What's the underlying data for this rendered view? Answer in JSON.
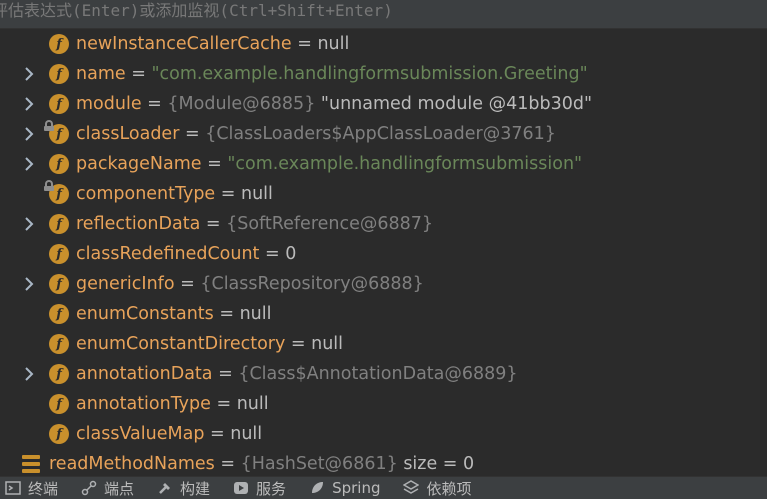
{
  "evaluate_bar": {
    "placeholder": "评估表达式(Enter)或添加监视(Ctrl+Shift+Enter)"
  },
  "variables": [
    {
      "name": "newInstanceCallerCache",
      "eq": "=",
      "value": "null",
      "value_type": "null",
      "expandable": false,
      "locked": false,
      "icon": "field-icon"
    },
    {
      "name": "name",
      "eq": "=",
      "value": "\"com.example.handlingformsubmission.Greeting\"",
      "value_type": "str",
      "expandable": true,
      "locked": false,
      "icon": "field-icon"
    },
    {
      "name": "module",
      "eq": "=",
      "ref": "{Module@6885}",
      "value": "\"unnamed module @41bb30d\"",
      "value_type": "plain",
      "expandable": true,
      "locked": false,
      "icon": "field-icon"
    },
    {
      "name": "classLoader",
      "eq": "=",
      "value": "{ClassLoaders$AppClassLoader@3761}",
      "value_type": "ref",
      "expandable": true,
      "locked": true,
      "icon": "field-icon"
    },
    {
      "name": "packageName",
      "eq": "=",
      "value": "\"com.example.handlingformsubmission\"",
      "value_type": "str",
      "expandable": true,
      "locked": false,
      "icon": "field-icon"
    },
    {
      "name": "componentType",
      "eq": "=",
      "value": "null",
      "value_type": "null",
      "expandable": false,
      "locked": true,
      "icon": "field-icon"
    },
    {
      "name": "reflectionData",
      "eq": "=",
      "value": "{SoftReference@6887}",
      "value_type": "ref",
      "expandable": true,
      "locked": false,
      "icon": "field-icon"
    },
    {
      "name": "classRedefinedCount",
      "eq": "=",
      "value": "0",
      "value_type": "num",
      "expandable": false,
      "locked": false,
      "icon": "field-icon"
    },
    {
      "name": "genericInfo",
      "eq": "=",
      "value": "{ClassRepository@6888}",
      "value_type": "ref",
      "expandable": true,
      "locked": false,
      "icon": "field-icon"
    },
    {
      "name": "enumConstants",
      "eq": "=",
      "value": "null",
      "value_type": "null",
      "expandable": false,
      "locked": false,
      "icon": "field-icon"
    },
    {
      "name": "enumConstantDirectory",
      "eq": "=",
      "value": "null",
      "value_type": "null",
      "expandable": false,
      "locked": false,
      "icon": "field-icon"
    },
    {
      "name": "annotationData",
      "eq": "=",
      "value": "{Class$AnnotationData@6889}",
      "value_type": "ref",
      "expandable": true,
      "locked": false,
      "icon": "field-icon"
    },
    {
      "name": "annotationType",
      "eq": "=",
      "value": "null",
      "value_type": "null",
      "expandable": false,
      "locked": false,
      "icon": "field-icon"
    },
    {
      "name": "classValueMap",
      "eq": "=",
      "value": "null",
      "value_type": "null",
      "expandable": false,
      "locked": false,
      "icon": "field-icon"
    },
    {
      "name": "readMethodNames",
      "eq": "=",
      "ref": "{HashSet@6861}",
      "value": "size = 0",
      "value_type": "plain",
      "expandable": false,
      "locked": false,
      "icon": "list-icon",
      "level": "outer"
    }
  ],
  "bottom_tabs": [
    {
      "label": "终端",
      "icon": "terminal-icon"
    },
    {
      "label": "端点",
      "icon": "endpoints-icon"
    },
    {
      "label": "构建",
      "icon": "build-icon"
    },
    {
      "label": "服务",
      "icon": "services-icon"
    },
    {
      "label": "Spring",
      "icon": "spring-icon"
    },
    {
      "label": "依赖项",
      "icon": "dependencies-icon"
    }
  ]
}
